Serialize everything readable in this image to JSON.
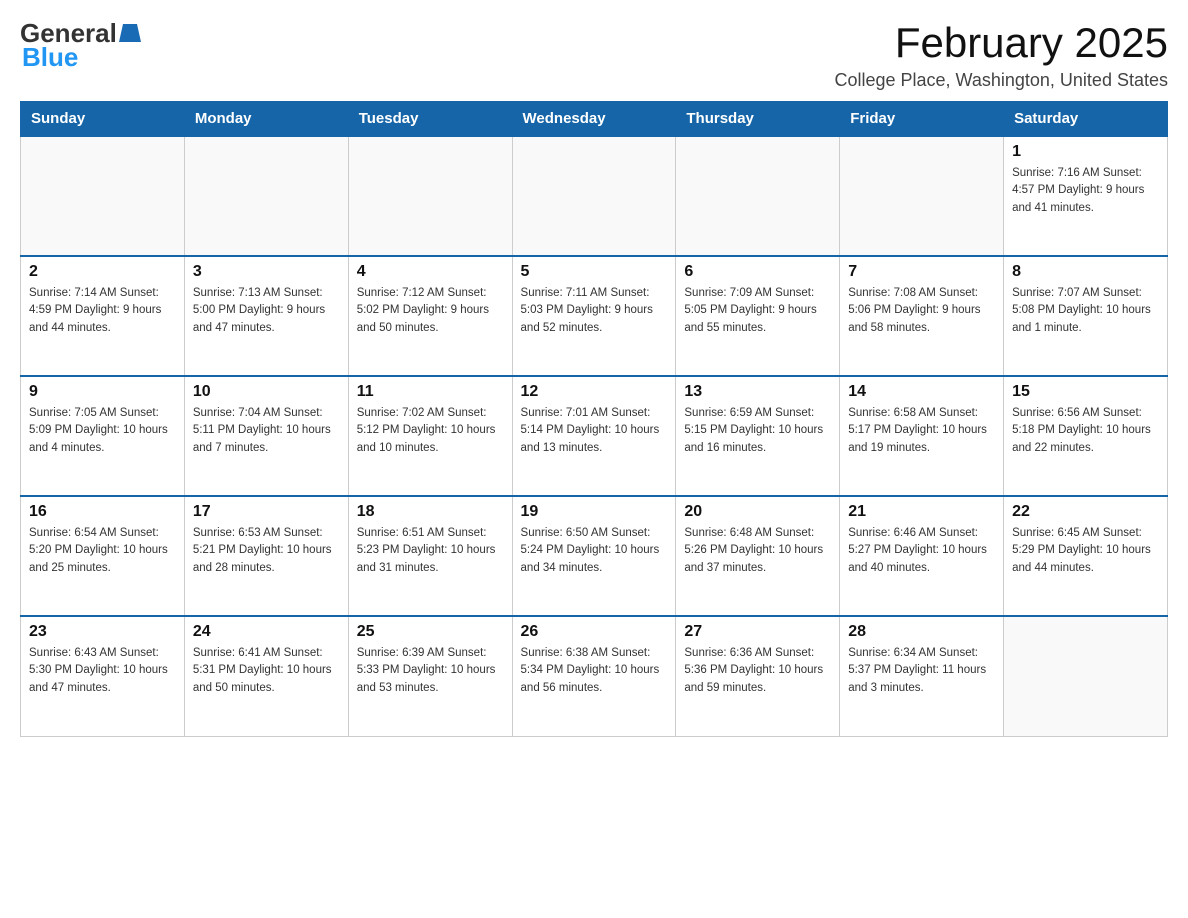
{
  "header": {
    "logo_general": "General",
    "logo_blue": "Blue",
    "month_title": "February 2025",
    "location": "College Place, Washington, United States"
  },
  "days_of_week": [
    "Sunday",
    "Monday",
    "Tuesday",
    "Wednesday",
    "Thursday",
    "Friday",
    "Saturday"
  ],
  "weeks": [
    [
      {
        "day": "",
        "info": ""
      },
      {
        "day": "",
        "info": ""
      },
      {
        "day": "",
        "info": ""
      },
      {
        "day": "",
        "info": ""
      },
      {
        "day": "",
        "info": ""
      },
      {
        "day": "",
        "info": ""
      },
      {
        "day": "1",
        "info": "Sunrise: 7:16 AM\nSunset: 4:57 PM\nDaylight: 9 hours and 41 minutes."
      }
    ],
    [
      {
        "day": "2",
        "info": "Sunrise: 7:14 AM\nSunset: 4:59 PM\nDaylight: 9 hours and 44 minutes."
      },
      {
        "day": "3",
        "info": "Sunrise: 7:13 AM\nSunset: 5:00 PM\nDaylight: 9 hours and 47 minutes."
      },
      {
        "day": "4",
        "info": "Sunrise: 7:12 AM\nSunset: 5:02 PM\nDaylight: 9 hours and 50 minutes."
      },
      {
        "day": "5",
        "info": "Sunrise: 7:11 AM\nSunset: 5:03 PM\nDaylight: 9 hours and 52 minutes."
      },
      {
        "day": "6",
        "info": "Sunrise: 7:09 AM\nSunset: 5:05 PM\nDaylight: 9 hours and 55 minutes."
      },
      {
        "day": "7",
        "info": "Sunrise: 7:08 AM\nSunset: 5:06 PM\nDaylight: 9 hours and 58 minutes."
      },
      {
        "day": "8",
        "info": "Sunrise: 7:07 AM\nSunset: 5:08 PM\nDaylight: 10 hours and 1 minute."
      }
    ],
    [
      {
        "day": "9",
        "info": "Sunrise: 7:05 AM\nSunset: 5:09 PM\nDaylight: 10 hours and 4 minutes."
      },
      {
        "day": "10",
        "info": "Sunrise: 7:04 AM\nSunset: 5:11 PM\nDaylight: 10 hours and 7 minutes."
      },
      {
        "day": "11",
        "info": "Sunrise: 7:02 AM\nSunset: 5:12 PM\nDaylight: 10 hours and 10 minutes."
      },
      {
        "day": "12",
        "info": "Sunrise: 7:01 AM\nSunset: 5:14 PM\nDaylight: 10 hours and 13 minutes."
      },
      {
        "day": "13",
        "info": "Sunrise: 6:59 AM\nSunset: 5:15 PM\nDaylight: 10 hours and 16 minutes."
      },
      {
        "day": "14",
        "info": "Sunrise: 6:58 AM\nSunset: 5:17 PM\nDaylight: 10 hours and 19 minutes."
      },
      {
        "day": "15",
        "info": "Sunrise: 6:56 AM\nSunset: 5:18 PM\nDaylight: 10 hours and 22 minutes."
      }
    ],
    [
      {
        "day": "16",
        "info": "Sunrise: 6:54 AM\nSunset: 5:20 PM\nDaylight: 10 hours and 25 minutes."
      },
      {
        "day": "17",
        "info": "Sunrise: 6:53 AM\nSunset: 5:21 PM\nDaylight: 10 hours and 28 minutes."
      },
      {
        "day": "18",
        "info": "Sunrise: 6:51 AM\nSunset: 5:23 PM\nDaylight: 10 hours and 31 minutes."
      },
      {
        "day": "19",
        "info": "Sunrise: 6:50 AM\nSunset: 5:24 PM\nDaylight: 10 hours and 34 minutes."
      },
      {
        "day": "20",
        "info": "Sunrise: 6:48 AM\nSunset: 5:26 PM\nDaylight: 10 hours and 37 minutes."
      },
      {
        "day": "21",
        "info": "Sunrise: 6:46 AM\nSunset: 5:27 PM\nDaylight: 10 hours and 40 minutes."
      },
      {
        "day": "22",
        "info": "Sunrise: 6:45 AM\nSunset: 5:29 PM\nDaylight: 10 hours and 44 minutes."
      }
    ],
    [
      {
        "day": "23",
        "info": "Sunrise: 6:43 AM\nSunset: 5:30 PM\nDaylight: 10 hours and 47 minutes."
      },
      {
        "day": "24",
        "info": "Sunrise: 6:41 AM\nSunset: 5:31 PM\nDaylight: 10 hours and 50 minutes."
      },
      {
        "day": "25",
        "info": "Sunrise: 6:39 AM\nSunset: 5:33 PM\nDaylight: 10 hours and 53 minutes."
      },
      {
        "day": "26",
        "info": "Sunrise: 6:38 AM\nSunset: 5:34 PM\nDaylight: 10 hours and 56 minutes."
      },
      {
        "day": "27",
        "info": "Sunrise: 6:36 AM\nSunset: 5:36 PM\nDaylight: 10 hours and 59 minutes."
      },
      {
        "day": "28",
        "info": "Sunrise: 6:34 AM\nSunset: 5:37 PM\nDaylight: 11 hours and 3 minutes."
      },
      {
        "day": "",
        "info": ""
      }
    ]
  ]
}
